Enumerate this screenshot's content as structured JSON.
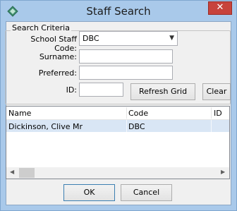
{
  "window": {
    "title": "Staff Search",
    "close_glyph": "✕"
  },
  "criteria": {
    "legend": "Search Criteria",
    "staff_code_label": "School Staff Code:",
    "staff_code_value": "DBC",
    "surname_label": "Surname:",
    "preferred_label": "Preferred:",
    "id_label": "ID:",
    "refresh_label": "Refresh Grid",
    "clear_label": "Clear"
  },
  "grid": {
    "columns": [
      "Name",
      "Code",
      "ID"
    ],
    "rows": [
      {
        "name": "Dickinson, Clive Mr",
        "code": "DBC",
        "id": ""
      }
    ]
  },
  "footer": {
    "ok_label": "OK",
    "cancel_label": "Cancel"
  },
  "icons": {
    "app": "app-diamond-icon",
    "close": "close-icon",
    "dropdown": "chevron-down-icon",
    "scroll_left": "scroll-left-icon",
    "scroll_right": "scroll-right-icon"
  },
  "colors": {
    "frame": "#a9c9ea",
    "close": "#c7433c",
    "selected_row": "#d9e6f5"
  }
}
